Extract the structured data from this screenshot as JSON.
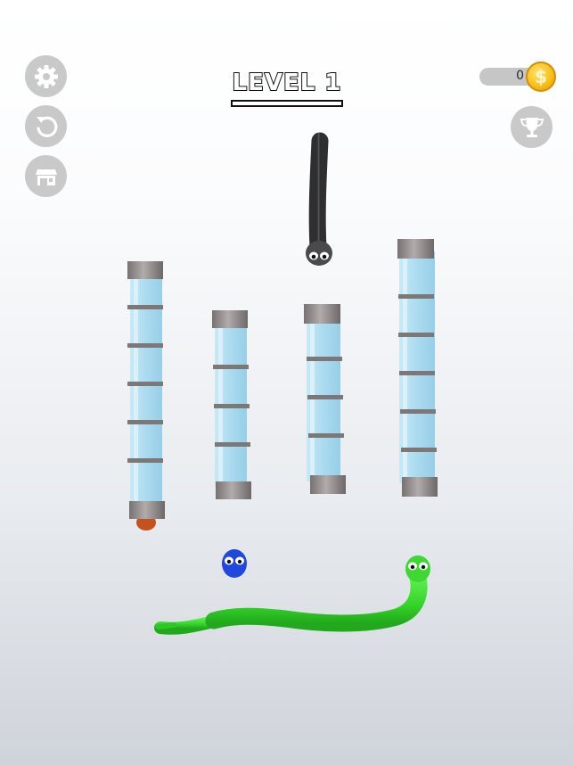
{
  "hud": {
    "level_label": "LEVEL 1",
    "coin_count": "0",
    "coin_symbol": "$"
  },
  "buttons": {
    "settings": "gear-icon",
    "restart": "restart-icon",
    "shop": "shop-icon",
    "trophy": "trophy-icon"
  },
  "game": {
    "tubes": 4,
    "snakes": [
      {
        "name": "gray",
        "color": "#4a4a4d"
      },
      {
        "name": "blue",
        "color": "#1f45d8"
      },
      {
        "name": "green",
        "color": "#33d62b"
      },
      {
        "name": "orange",
        "color": "#c5521d"
      }
    ],
    "colors": {
      "tube_glass": "#a9dbef",
      "tube_cap": "#8f8988"
    }
  }
}
